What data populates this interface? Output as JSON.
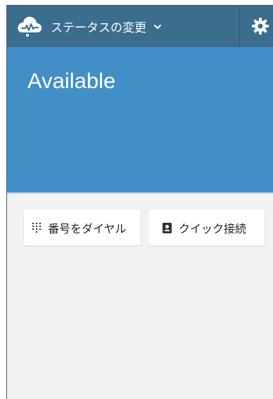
{
  "header": {
    "status_menu_label": "ステータスの変更",
    "icons": {
      "logo": "cloud-signal-logo-icon",
      "chevron": "chevron-down-icon",
      "settings": "gear-icon"
    }
  },
  "status": {
    "current": "Available"
  },
  "actions": {
    "dial_label": "番号をダイヤル",
    "quick_connect_label": "クイック接続",
    "icons": {
      "dial": "keypad-icon",
      "quick_connect": "contact-book-icon"
    }
  },
  "colors": {
    "topbar": "#3b6d8f",
    "status_panel": "#428fc8",
    "background": "#f2f2f2"
  }
}
